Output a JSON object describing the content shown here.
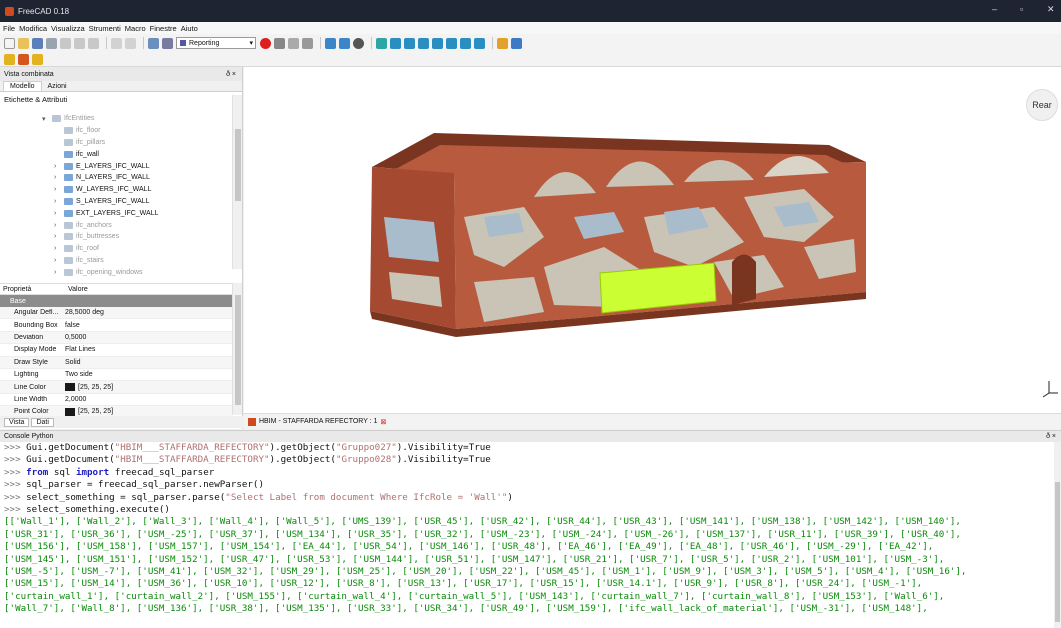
{
  "window": {
    "title": "FreeCAD 0.18",
    "minimize": "–",
    "maximize": "▫",
    "close": "✕"
  },
  "menu": [
    "File",
    "Modifica",
    "Visualizza",
    "Strumenti",
    "Macro",
    "Finestre",
    "Aiuto"
  ],
  "toolbar": {
    "workbench": "Reporting",
    "dropdown_arrow": "▾"
  },
  "combo_view": {
    "title": "Vista combinata",
    "controls": "ð ×",
    "tabs": [
      "Modello",
      "Azioni"
    ],
    "tree_header": "Etichette & Attributi",
    "tree": [
      {
        "label": "IfcEntities",
        "arrow": "▾",
        "dim": true,
        "indent": 42
      },
      {
        "label": "ifc_floor",
        "arrow": "",
        "dim": true,
        "indent": 54
      },
      {
        "label": "ifc_pillars",
        "arrow": "",
        "dim": true,
        "indent": 54
      },
      {
        "label": "ifc_wall",
        "arrow": "",
        "dim": false,
        "indent": 54
      },
      {
        "label": "E_LAYERS_IFC_WALL",
        "arrow": "›",
        "dim": false,
        "indent": 54
      },
      {
        "label": "N_LAYERS_IFC_WALL",
        "arrow": "›",
        "dim": false,
        "indent": 54
      },
      {
        "label": "W_LAYERS_IFC_WALL",
        "arrow": "›",
        "dim": false,
        "indent": 54
      },
      {
        "label": "S_LAYERS_IFC_WALL",
        "arrow": "›",
        "dim": false,
        "indent": 54
      },
      {
        "label": "EXT_LAYERS_IFC_WALL",
        "arrow": "›",
        "dim": false,
        "indent": 54
      },
      {
        "label": "ifc_anchors",
        "arrow": "›",
        "dim": true,
        "indent": 54
      },
      {
        "label": "ifc_buttresses",
        "arrow": "›",
        "dim": true,
        "indent": 54
      },
      {
        "label": "ifc_roof",
        "arrow": "›",
        "dim": true,
        "indent": 54
      },
      {
        "label": "ifc_stairs",
        "arrow": "›",
        "dim": true,
        "indent": 54
      },
      {
        "label": "ifc_opening_windows",
        "arrow": "›",
        "dim": true,
        "indent": 54
      }
    ],
    "prop_columns": [
      "Proprietà",
      "Valore"
    ],
    "prop_group": "Base",
    "properties": [
      {
        "name": "Angular Defl...",
        "value": "28,5000 deg",
        "swatch": false
      },
      {
        "name": "Bounding Box",
        "value": "false",
        "swatch": false
      },
      {
        "name": "Deviation",
        "value": "0,5000",
        "swatch": false
      },
      {
        "name": "Display Mode",
        "value": "Flat Lines",
        "swatch": false
      },
      {
        "name": "Draw Style",
        "value": "Solid",
        "swatch": false
      },
      {
        "name": "Lighting",
        "value": "Two side",
        "swatch": false
      },
      {
        "name": "Line Color",
        "value": "[25, 25, 25]",
        "swatch": true
      },
      {
        "name": "Line Width",
        "value": "2,0000",
        "swatch": false
      },
      {
        "name": "Point Color",
        "value": "[25, 25, 25]",
        "swatch": true
      }
    ],
    "bottom_tabs": [
      "Vista",
      "Dati"
    ]
  },
  "navcube": {
    "face_label": "Rear"
  },
  "document_tab": {
    "label": "HBIM - STAFFARDA REFECTORY : 1",
    "close": "⊠"
  },
  "console": {
    "title": "Console Python",
    "prompt": ">>> ",
    "lines": [
      {
        "parts": [
          [
            "pr",
            ">>> "
          ],
          [
            "t",
            "Gui.getDocument("
          ],
          [
            "str",
            "\"HBIM___STAFFARDA_REFECTORY\""
          ],
          [
            "t",
            ").getObject("
          ],
          [
            "str",
            "\"Gruppo027\""
          ],
          [
            "t",
            ").Visibility=True"
          ]
        ]
      },
      {
        "parts": [
          [
            "pr",
            ">>> "
          ],
          [
            "t",
            "Gui.getDocument("
          ],
          [
            "str",
            "\"HBIM___STAFFARDA_REFECTORY\""
          ],
          [
            "t",
            ").getObject("
          ],
          [
            "str",
            "\"Gruppo028\""
          ],
          [
            "t",
            ").Visibility=True"
          ]
        ]
      },
      {
        "parts": [
          [
            "pr",
            ">>> "
          ],
          [
            "kw",
            "from"
          ],
          [
            "t",
            " sql "
          ],
          [
            "kw",
            "import"
          ],
          [
            "t",
            " freecad_sql_parser"
          ]
        ]
      },
      {
        "parts": [
          [
            "pr",
            ">>> "
          ],
          [
            "t",
            "sql_parser = freecad_sql_parser.newParser()"
          ]
        ]
      },
      {
        "parts": [
          [
            "pr",
            ">>> "
          ],
          [
            "t",
            "select_something = sql_parser.parse("
          ],
          [
            "str",
            "\"Select Label from document Where IfcRole = 'Wall'\""
          ],
          [
            "t",
            ")"
          ]
        ]
      },
      {
        "parts": [
          [
            "pr",
            ">>> "
          ],
          [
            "t",
            "select_something.execute()"
          ]
        ]
      },
      {
        "parts": [
          [
            "out",
            "[['Wall_1'], ['Wall_2'], ['Wall_3'], ['Wall_4'], ['Wall_5'], ['UMS_139'], ['USR_45'], ['USR_42'], ['USR_44'], ['USR_43'], ['USM_141'], ['USM_138'], ['USM_142'], ['USM_140'],"
          ]
        ]
      },
      {
        "parts": [
          [
            "out",
            "['USR_31'], ['USR_36'], ['USM_-25'], ['USR_37'], ['USM_134'], ['USR_35'], ['USR_32'], ['USM_-23'], ['USM_-24'], ['USM_-26'], ['USM_137'], ['USR_11'], ['USR_39'], ['USR_40'],"
          ]
        ]
      },
      {
        "parts": [
          [
            "out",
            "['USM_156'], ['USM_158'], ['USM_157'], ['USM_154'], ['EA_44'], ['USR_54'], ['USM_146'], ['USR_48'], ['EA_46'], ['EA_49'], ['EA_48'], ['USR_46'], ['USM_-29'], ['EA_42'],"
          ]
        ]
      },
      {
        "parts": [
          [
            "out",
            "['USM_145'], ['USM_151'], ['USM_152'], ['USR_47'], ['USR_53'], ['USM_144'], ['USR_51'], ['USM_147'], ['USR_21'], ['USR_7'], ['USR_5'], ['USR_2'], ['USM_101'], ['USM_-3'],"
          ]
        ]
      },
      {
        "parts": [
          [
            "out",
            "['USM_-5'], ['USM_-7'], ['USM_41'], ['USM_32'], ['USM_29'], ['USM_25'], ['USM_20'], ['USM_22'], ['USM_45'], ['USM_1'], ['USM_9'], ['USM_3'], ['USM_5'], ['USM_4'], ['USM_16'],"
          ]
        ]
      },
      {
        "parts": [
          [
            "out",
            "['USM_15'], ['USM_14'], ['USM_36'], ['USR_10'], ['USR_12'], ['USR_8'], ['USR_13'], ['USR_17'], ['USR_15'], ['USR_14.1'], ['USR_9'], ['USR_8'], ['USR_24'], ['USM_-1'],"
          ]
        ]
      },
      {
        "parts": [
          [
            "out",
            "['curtain_wall_1'], ['curtain_wall_2'], ['USM_155'], ['curtain_wall_4'], ['curtain_wall_5'], ['USM_143'], ['curtain_wall_7'], ['curtain_wall_8'], ['USM_153'], ['Wall_6'],"
          ]
        ]
      },
      {
        "parts": [
          [
            "out",
            "['Wall_7'], ['Wall_8'], ['USM_136'], ['USR_38'], ['USM_135'], ['USR_33'], ['USR_34'], ['USR_49'], ['USM_159'], ['ifc_wall_lack_of_material'], ['USM_-31'], ['USM_148'],"
          ]
        ]
      }
    ]
  },
  "colors": {
    "wall_brick": "#b85a3e",
    "wall_dark": "#7a3520",
    "plaster": "#c9c4b6",
    "stone_blue": "#a9bccb",
    "highlight": "#ccff33",
    "console_output": "#0a8a0a",
    "console_string": "#b07070"
  }
}
